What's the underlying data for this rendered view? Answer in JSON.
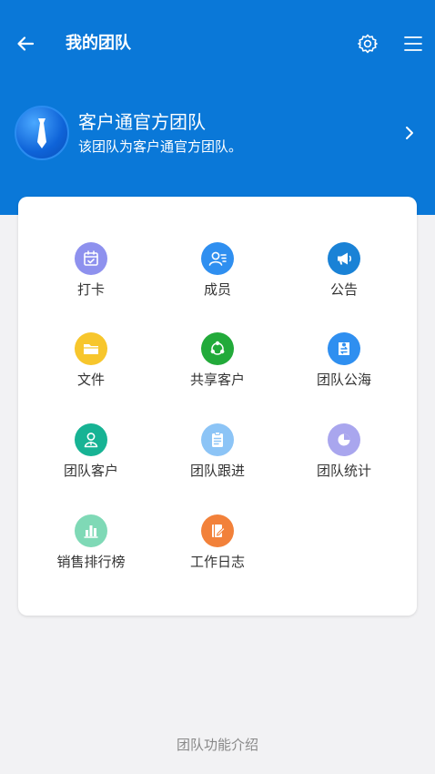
{
  "header": {
    "title": "我的团队",
    "bg_color": "#0a78d8"
  },
  "team": {
    "name": "客户通官方团队",
    "description": "该团队为客户通官方团队。"
  },
  "features": [
    {
      "label": "打卡",
      "icon": "calendar-check-icon",
      "color": "#8e91ee"
    },
    {
      "label": "成员",
      "icon": "members-icon",
      "color": "#2f8ff0"
    },
    {
      "label": "公告",
      "icon": "megaphone-icon",
      "color": "#1a82d6"
    },
    {
      "label": "文件",
      "icon": "folder-icon",
      "color": "#f7c62c"
    },
    {
      "label": "共享客户",
      "icon": "share-icon",
      "color": "#22aa3a"
    },
    {
      "label": "团队公海",
      "icon": "public-pool-icon",
      "color": "#2f8ff0"
    },
    {
      "label": "团队客户",
      "icon": "team-customer-icon",
      "color": "#17b394"
    },
    {
      "label": "团队跟进",
      "icon": "clipboard-icon",
      "color": "#8cc4f6"
    },
    {
      "label": "团队统计",
      "icon": "pie-chart-icon",
      "color": "#a9a6ee"
    },
    {
      "label": "销售排行榜",
      "icon": "bar-chart-icon",
      "color": "#7fd9b6"
    },
    {
      "label": "工作日志",
      "icon": "journal-icon",
      "color": "#f2813a"
    }
  ],
  "footer": {
    "link_label": "团队功能介绍"
  }
}
